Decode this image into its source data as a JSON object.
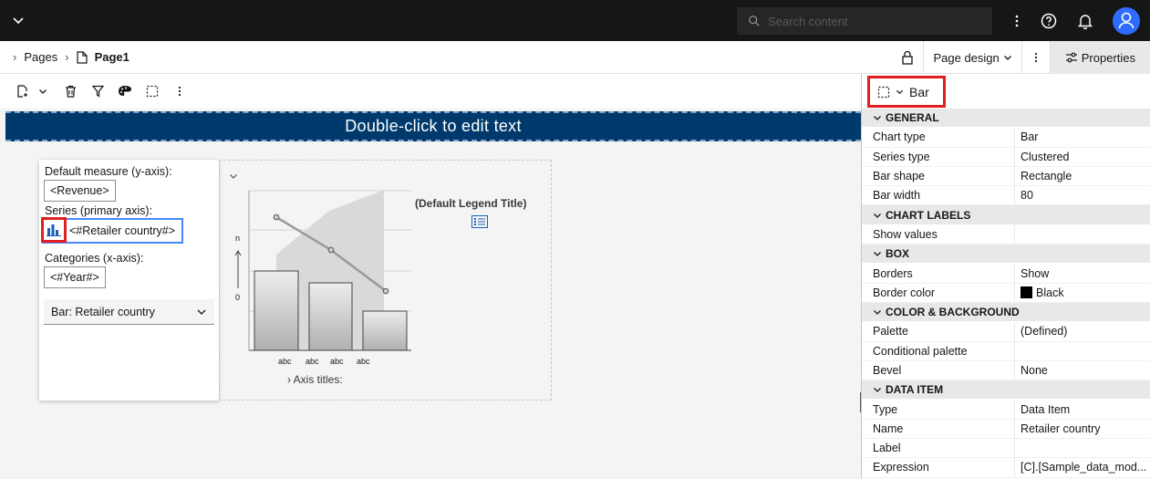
{
  "topbar": {
    "search_placeholder": "Search content",
    "icons": [
      "chevron-down-icon",
      "search-icon",
      "overflow-menu-icon",
      "help-icon",
      "notification-icon",
      "user-avatar-icon"
    ]
  },
  "breadcrumb": {
    "items": [
      "Pages",
      "Page1"
    ]
  },
  "crumb_actions": {
    "page_design": "Page design",
    "properties": "Properties"
  },
  "canvas": {
    "title_text": "Double-click to edit text"
  },
  "data_panel": {
    "default_measure_label": "Default measure (y-axis):",
    "default_measure_value": "<Revenue>",
    "series_label": "Series (primary axis):",
    "series_value": "<#Retailer country#>",
    "categories_label": "Categories (x-axis):",
    "categories_value": "<#Year#>",
    "dropdown_value": "Bar: Retailer country"
  },
  "chart_preview": {
    "legend_title": "(Default Legend Title)",
    "y_axis_top": "n",
    "y_axis_bottom": "0",
    "x_labels": [
      "abc",
      "abc",
      "abc",
      "abc"
    ],
    "axis_titles": "› Axis titles:"
  },
  "properties": {
    "object": "Bar",
    "sections": [
      {
        "title": "GENERAL",
        "rows": [
          {
            "k": "Chart type",
            "v": "Bar"
          },
          {
            "k": "Series type",
            "v": "Clustered"
          },
          {
            "k": "Bar shape",
            "v": "Rectangle"
          },
          {
            "k": "Bar width",
            "v": "80"
          }
        ]
      },
      {
        "title": "CHART LABELS",
        "rows": [
          {
            "k": "Show values",
            "v": ""
          }
        ]
      },
      {
        "title": "BOX",
        "rows": [
          {
            "k": "Borders",
            "v": "Show"
          },
          {
            "k": "Border color",
            "v": "Black",
            "swatch": "#000000"
          }
        ]
      },
      {
        "title": "COLOR & BACKGROUND",
        "rows": [
          {
            "k": "Palette",
            "v": "(Defined)"
          },
          {
            "k": "Conditional palette",
            "v": ""
          },
          {
            "k": "Bevel",
            "v": "None"
          }
        ]
      },
      {
        "title": "DATA ITEM",
        "rows": [
          {
            "k": "Type",
            "v": "Data Item"
          },
          {
            "k": "Name",
            "v": "Retailer country"
          },
          {
            "k": "Label",
            "v": ""
          },
          {
            "k": "Expression",
            "v": "[C].[Sample_data_mod..."
          }
        ]
      }
    ]
  },
  "colors": {
    "topbar_bg": "#161616",
    "title_bg": "#003a6d",
    "highlight_red": "#e02020",
    "highlight_blue": "#4589ff",
    "avatar": "#2f6bff"
  }
}
